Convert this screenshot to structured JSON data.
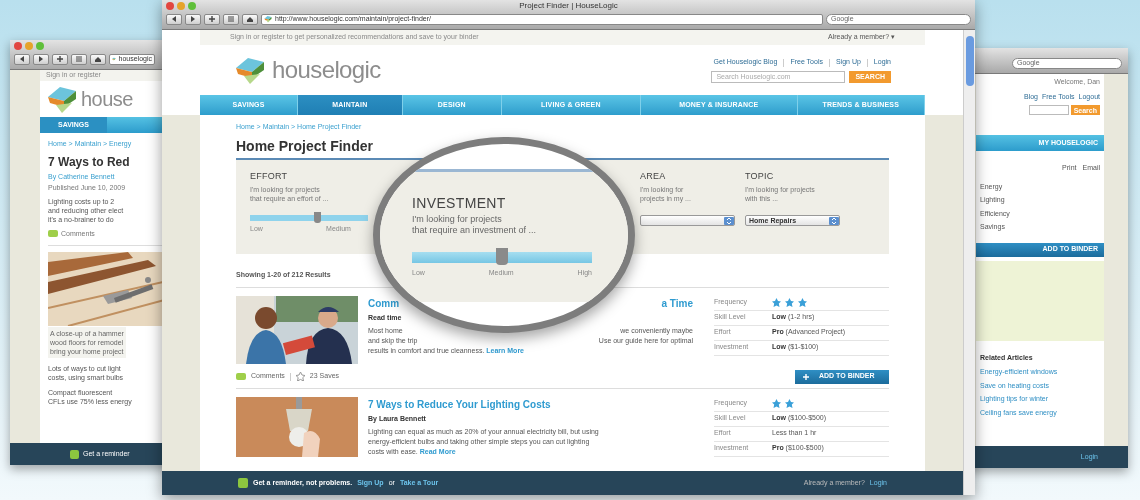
{
  "left_window": {
    "url": "houselogic",
    "top_note": "Sign in or register",
    "brand": "house",
    "nav": [
      {
        "label": "SAVINGS",
        "selected": true
      }
    ],
    "breadcrumb": "Home > Maintain > Energy",
    "title": "7 Ways to Red",
    "byline": "By Catherine Bennett",
    "date": "Published June 10, 2009",
    "intro": [
      "Lighting costs up to 2",
      "and reducing other elect",
      "it's a no-brainer to do"
    ],
    "comments": "Comments",
    "caption": [
      "A close-up of a hammer",
      "wood floors for remodel",
      "bring your home project"
    ],
    "paragraphs": [
      [
        "Lots of ways to cut light",
        "costs, using smart bulbs"
      ],
      [
        "Compact fluorescent",
        "CFLs use 75% less energy"
      ]
    ],
    "footer": "Get a reminder"
  },
  "right_window": {
    "search_placeholder": "Google",
    "welcome": "Welcome, Dan",
    "links": [
      "Blog",
      "Free Tools",
      "Logout"
    ],
    "search_button": "Search",
    "tab": "MY HOUSELOGIC",
    "print": "Print",
    "email": "Email",
    "list": [
      "Energy",
      "Lighting",
      "Efficiency",
      "Savings"
    ],
    "binder_button": "ADD TO BINDER",
    "related_title": "Related Articles",
    "related": [
      "Energy-efficient windows",
      "Save on heating costs",
      "Lighting tips for winter",
      "Ceiling fans save energy"
    ],
    "footer": "Login"
  },
  "main_window": {
    "title": "Project Finder | HouseLogic",
    "url": "http://www.houselogic.com/maintain/project-finder/",
    "search_placeholder": "Google",
    "top_note": "Sign in or register to get personalized recommendations and save to your binder",
    "top_right": "Already a member? ▾",
    "brand": "houselogic",
    "header_links": [
      "Get Houselogic Blog",
      "Free Tools",
      "Sign Up",
      "Login"
    ],
    "site_search_placeholder": "Search Houselogic.com",
    "site_search_button": "SEARCH",
    "nav": [
      {
        "label": "SAVINGS",
        "selected": false
      },
      {
        "label": "MAINTAIN",
        "selected": true
      },
      {
        "label": "DESIGN",
        "selected": false
      },
      {
        "label": "LIVING & GREEN",
        "selected": false
      },
      {
        "label": "MONEY & INSURANCE",
        "selected": false
      },
      {
        "label": "TRENDS & BUSINESS",
        "selected": false
      }
    ],
    "breadcrumb": "Home > Maintain > Home Project Finder",
    "heading": "Home Project Finder",
    "filters": [
      {
        "kind": "slider",
        "label": "EFFORT",
        "description": [
          "I'm looking for projects",
          "that require an effort of ..."
        ],
        "level": 0.57,
        "ticks": [
          "Low",
          "Medium"
        ]
      },
      {
        "kind": "hidden"
      },
      {
        "kind": "select",
        "label": "AREA",
        "description": [
          "I'm looking for",
          "projects in my ..."
        ]
      },
      {
        "kind": "select",
        "label": "TOPIC",
        "description": [
          "I'm looking for projects",
          "with this ..."
        ],
        "value": "Home Repairs"
      }
    ],
    "results_count": "Showing 1-20 of 212 Results",
    "results": [
      {
        "title": [
          "Comm",
          "a Time"
        ],
        "byline": "Read time",
        "lines": [
          [
            "Most home",
            "we conveniently maybe"
          ],
          [
            "and skip the trip",
            "Use our guide here for optimal"
          ],
          [
            "results in comfort and true cleanness.   "
          ]
        ],
        "more": "Learn More",
        "details": [
          {
            "label": "Frequency",
            "kind": "icons",
            "icons": [
              {
                "kind": "star"
              },
              {
                "kind": "star"
              },
              {
                "kind": "star"
              }
            ]
          },
          {
            "label": "Skill Level",
            "kind": "text",
            "bold": "Low",
            "rest": "(1-2 hrs)"
          },
          {
            "label": "Effort",
            "kind": "text",
            "bold": "Pro",
            "rest": "(Advanced Project)"
          },
          {
            "label": "Investment",
            "kind": "text",
            "bold": "Low",
            "rest": "($1-$100)"
          }
        ],
        "comments": "Comments",
        "saves": "23 Saves",
        "binder_button": "ADD TO BINDER"
      },
      {
        "title": [
          "7 Ways to Reduce Your Lighting Costs"
        ],
        "byline": "By Laura Bennett",
        "lines": [
          [
            "Lighting can equal as much as 20% of your annual electricity bill, but using"
          ],
          [
            "energy-efficient bulbs and taking other simple steps you can cut lighting"
          ],
          [
            "costs with ease.  "
          ]
        ],
        "more": "Read More",
        "details": [
          {
            "label": "Frequency",
            "kind": "icons",
            "icons": [
              {
                "kind": "star"
              },
              {
                "kind": "star"
              }
            ]
          },
          {
            "label": "Skill Level",
            "kind": "text",
            "bold": "Low",
            "rest": "($100-$500)"
          },
          {
            "label": "Effort",
            "kind": "text",
            "rest": "Less than 1 hr"
          },
          {
            "label": "Investment",
            "kind": "text",
            "bold": "Pro",
            "rest": "($100-$500)"
          }
        ]
      }
    ],
    "footer": {
      "text": "Get a reminder, not problems.",
      "signup": "Sign Up",
      "or": "or",
      "tour": "Take a Tour",
      "right": "Already a member?",
      "login": "Login"
    }
  },
  "magnifier": {
    "label": "INVESTMENT",
    "description": [
      "I'm looking for projects",
      "that require an investment of ..."
    ],
    "level": 0.5,
    "ticks": [
      "Low",
      "Medium",
      "High"
    ]
  }
}
